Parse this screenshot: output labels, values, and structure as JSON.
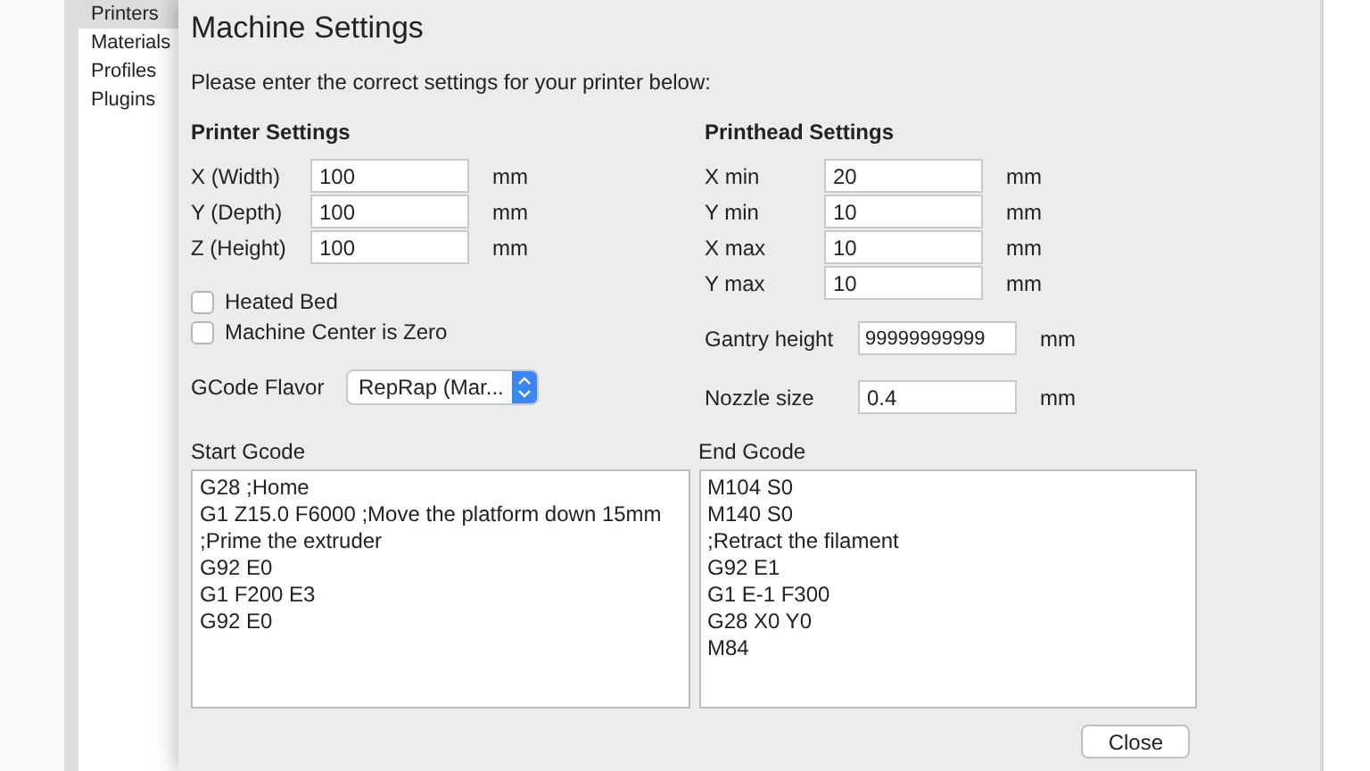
{
  "sidebar": {
    "items": [
      {
        "label": "Printers",
        "selected": true
      },
      {
        "label": "Materials",
        "selected": false
      },
      {
        "label": "Profiles",
        "selected": false
      },
      {
        "label": "Plugins",
        "selected": false
      }
    ]
  },
  "dialog": {
    "title": "Machine Settings",
    "intro": "Please enter the correct settings for your printer below:",
    "printer_settings": {
      "heading": "Printer Settings",
      "fields": [
        {
          "label": "X (Width)",
          "value": "100",
          "unit": "mm"
        },
        {
          "label": "Y (Depth)",
          "value": "100",
          "unit": "mm"
        },
        {
          "label": "Z (Height)",
          "value": "100",
          "unit": "mm"
        }
      ],
      "checkboxes": [
        {
          "label": "Heated Bed",
          "checked": false
        },
        {
          "label": "Machine Center is Zero",
          "checked": false
        }
      ],
      "gcode_flavor": {
        "label": "GCode Flavor",
        "value": "RepRap (Mar..."
      }
    },
    "printhead_settings": {
      "heading": "Printhead Settings",
      "fields": [
        {
          "label": "X min",
          "value": "20",
          "unit": "mm"
        },
        {
          "label": "Y min",
          "value": "10",
          "unit": "mm"
        },
        {
          "label": "X max",
          "value": "10",
          "unit": "mm"
        },
        {
          "label": "Y max",
          "value": "10",
          "unit": "mm"
        }
      ],
      "gantry_height": {
        "label": "Gantry height",
        "value": "99999999999",
        "unit": "mm"
      },
      "nozzle_size": {
        "label": "Nozzle size",
        "value": "0.4",
        "unit": "mm"
      }
    },
    "start_gcode": {
      "label": "Start Gcode",
      "lines": [
        "G28 ;Home",
        "G1 Z15.0 F6000 ;Move the platform down 15mm",
        ";Prime the extruder",
        "G92 E0",
        "G1 F200 E3",
        "G92 E0"
      ]
    },
    "end_gcode": {
      "label": "End Gcode",
      "lines": [
        "M104 S0",
        "M140 S0",
        ";Retract the filament",
        "G92 E1",
        "G1 E-1 F300",
        "G28 X0 Y0",
        "M84"
      ]
    },
    "buttons": [
      "Close"
    ]
  }
}
